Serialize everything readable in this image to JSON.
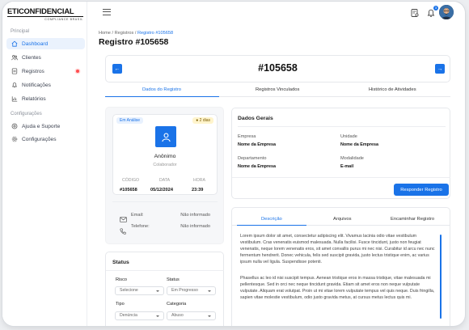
{
  "brand": {
    "name": "ETICONFIDENCIAL",
    "tagline": "COMPLIANCE BRASIL"
  },
  "sidebar": {
    "section_main": "Principal",
    "items_main": [
      {
        "label": "Dashboard",
        "icon": "home-icon",
        "active": true
      },
      {
        "label": "Clientes",
        "icon": "users-icon"
      },
      {
        "label": "Registros",
        "icon": "file-icon",
        "badge": "red-dot"
      },
      {
        "label": "Notificações",
        "icon": "bell-icon"
      },
      {
        "label": "Relatórios",
        "icon": "chart-icon"
      }
    ],
    "section_config": "Configurações",
    "items_config": [
      {
        "label": "Ajuda e Suporte",
        "icon": "help-icon"
      },
      {
        "label": "Configurações",
        "icon": "gear-icon"
      }
    ]
  },
  "topbar": {
    "notification_count": "3"
  },
  "breadcrumb": {
    "home": "Home",
    "sep": "/",
    "registros": "Registros",
    "current": "Registro #105658"
  },
  "page": {
    "title": "Registro #105658"
  },
  "record_nav": {
    "id": "#105658",
    "prev": "←",
    "next": "→"
  },
  "tabs": [
    "Dados do Registro",
    "Registros Vinculados",
    "Histórico de Atividades"
  ],
  "person": {
    "status": "Em Análise",
    "age_badge": "2 dias",
    "name": "Anônimo",
    "role": "Colaborador",
    "code_label": "CÓDIGO",
    "code": "#105658",
    "date_label": "DATA",
    "date": "05/12/2024",
    "time_label": "HORA",
    "time": "23:39",
    "email_label": "Email:",
    "email": "Não informado",
    "phone_label": "Telefone:",
    "phone": "Não informado"
  },
  "general": {
    "title": "Dados Gerais",
    "empresa_label": "Empresa",
    "empresa": "Nome da Empresa",
    "unidade_label": "Unidade",
    "unidade": "Nome da Empresa",
    "departamento_label": "Departamento",
    "departamento": "Nome da Empresa",
    "modalidade_label": "Modalidade",
    "modalidade": "E-mail",
    "respond_button": "Responder Registro"
  },
  "status": {
    "title": "Status",
    "risco_label": "Risco",
    "risco_value": "Selecione",
    "status_label": "Status",
    "status_value": "Em Progresso",
    "tipo_label": "Tipo",
    "tipo_value": "Denúncia",
    "categoria_label": "Categoria",
    "categoria_value": "Abuso"
  },
  "detail_tabs": [
    "Descrição",
    "Arquivos",
    "Encaminhar Registro"
  ],
  "description": {
    "p1": "Lorem ipsum dolor sit amet, consectetur adipiscing elit. Vivamus lacinia odio vitae vestibulum vestibulum. Cras venenatis euismod malesuada. Nulla facilisi. Fusce tincidunt, justo non feugiat venenatis, neque lorem venenatis eros, sit amet convallis purus mi nec nisi. Curabitur id arcu nec nunc fermentum hendrerit. Donec vehicula, felis sed suscipit gravida, justo lectus tristique enim, ac varius ipsum nulla vel ligula. Suspendisse potenti.",
    "p2": "Phasellus ac leo id nisi suscipit tempus. Aenean tristique eros in massa tristique, vitae malesuada mi pellentesque. Sed in orci nec neque tincidunt gravida. Etiam sit amet eros non neque vulputate vulputate. Aliquam erat volutpat. Proin ut mi vitae lorem vulputate tempus vel quis neque. Duis fringilla, sapien vitae molestie vestibulum, odio justo gravida metus, at cursus metus lectus quis mi."
  },
  "colors": {
    "accent": "#1a73e8",
    "alert": "#ff4d4f",
    "badge_bg": "#fff4cc"
  }
}
